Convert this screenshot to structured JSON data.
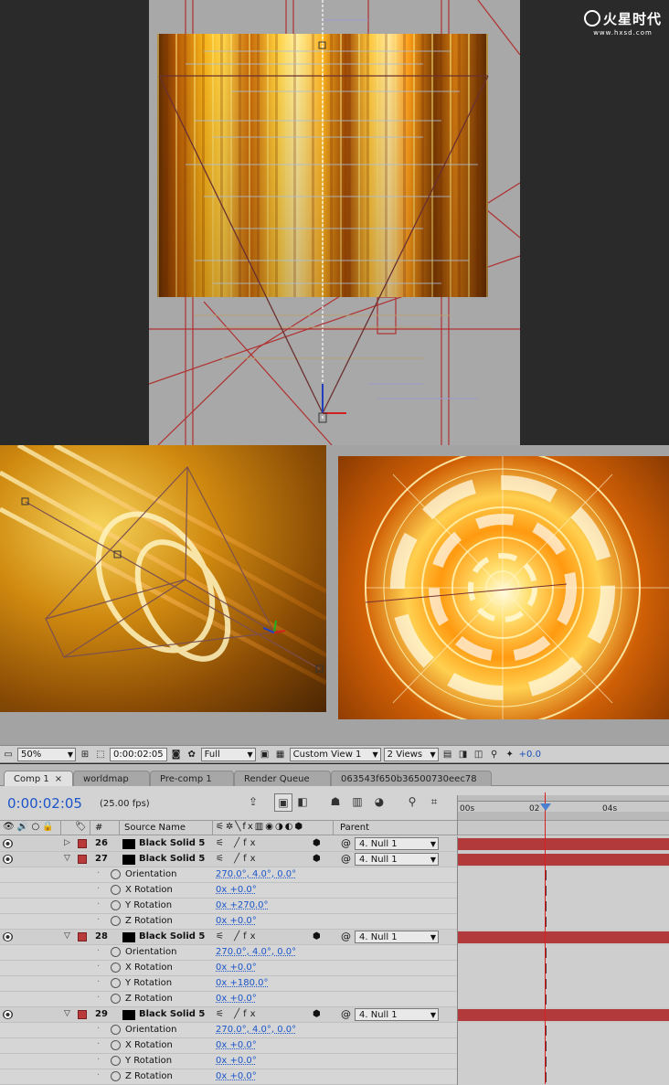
{
  "brand": {
    "logo_text": "火星时代",
    "site": "www.hxsd.com"
  },
  "viewer_toolbar": {
    "zoom": "50%",
    "timecode": "0:00:02:05",
    "resolution": "Full",
    "view": "Custom View 1",
    "views_layout": "2 Views",
    "exposure": "+0.0"
  },
  "tabs": [
    {
      "label": "Comp 1",
      "active": true
    },
    {
      "label": "worldmap"
    },
    {
      "label": "Pre-comp 1"
    },
    {
      "label": "Render Queue"
    },
    {
      "label": "063543f650b36500730eec78"
    }
  ],
  "timeline": {
    "current_time": "0:00:02:05",
    "fps": "(25.00 fps)",
    "ruler": [
      "00s",
      "02",
      "04s"
    ],
    "columns": {
      "number": "#",
      "source_name": "Source Name",
      "parent": "Parent"
    },
    "layers": [
      {
        "number": "26",
        "name": "Black Solid 5",
        "expanded": false,
        "parent": "4. Null 1",
        "properties": []
      },
      {
        "number": "27",
        "name": "Black Solid 5",
        "expanded": true,
        "parent": "4. Null 1",
        "properties": [
          {
            "name": "Orientation",
            "value": "270.0°, 4.0°, 0.0°"
          },
          {
            "name": "X Rotation",
            "value": "0x +0.0°"
          },
          {
            "name": "Y Rotation",
            "value": "0x +270.0°"
          },
          {
            "name": "Z Rotation",
            "value": "0x +0.0°"
          }
        ]
      },
      {
        "number": "28",
        "name": "Black Solid 5",
        "expanded": true,
        "parent": "4. Null 1",
        "properties": [
          {
            "name": "Orientation",
            "value": "270.0°, 4.0°, 0.0°"
          },
          {
            "name": "X Rotation",
            "value": "0x +0.0°"
          },
          {
            "name": "Y Rotation",
            "value": "0x +180.0°"
          },
          {
            "name": "Z Rotation",
            "value": "0x +0.0°"
          }
        ]
      },
      {
        "number": "29",
        "name": "Black Solid 5",
        "expanded": true,
        "parent": "4. Null 1",
        "properties": [
          {
            "name": "Orientation",
            "value": "270.0°, 4.0°, 0.0°"
          },
          {
            "name": "X Rotation",
            "value": "0x +0.0°"
          },
          {
            "name": "Y Rotation",
            "value": "0x +0.0°"
          },
          {
            "name": "Z Rotation",
            "value": "0x +0.0°"
          }
        ]
      }
    ]
  },
  "colors": {
    "timecode_blue": "#1b55c9",
    "layer_bar_red": "#b33a3a",
    "playhead_red": "#d82020"
  }
}
